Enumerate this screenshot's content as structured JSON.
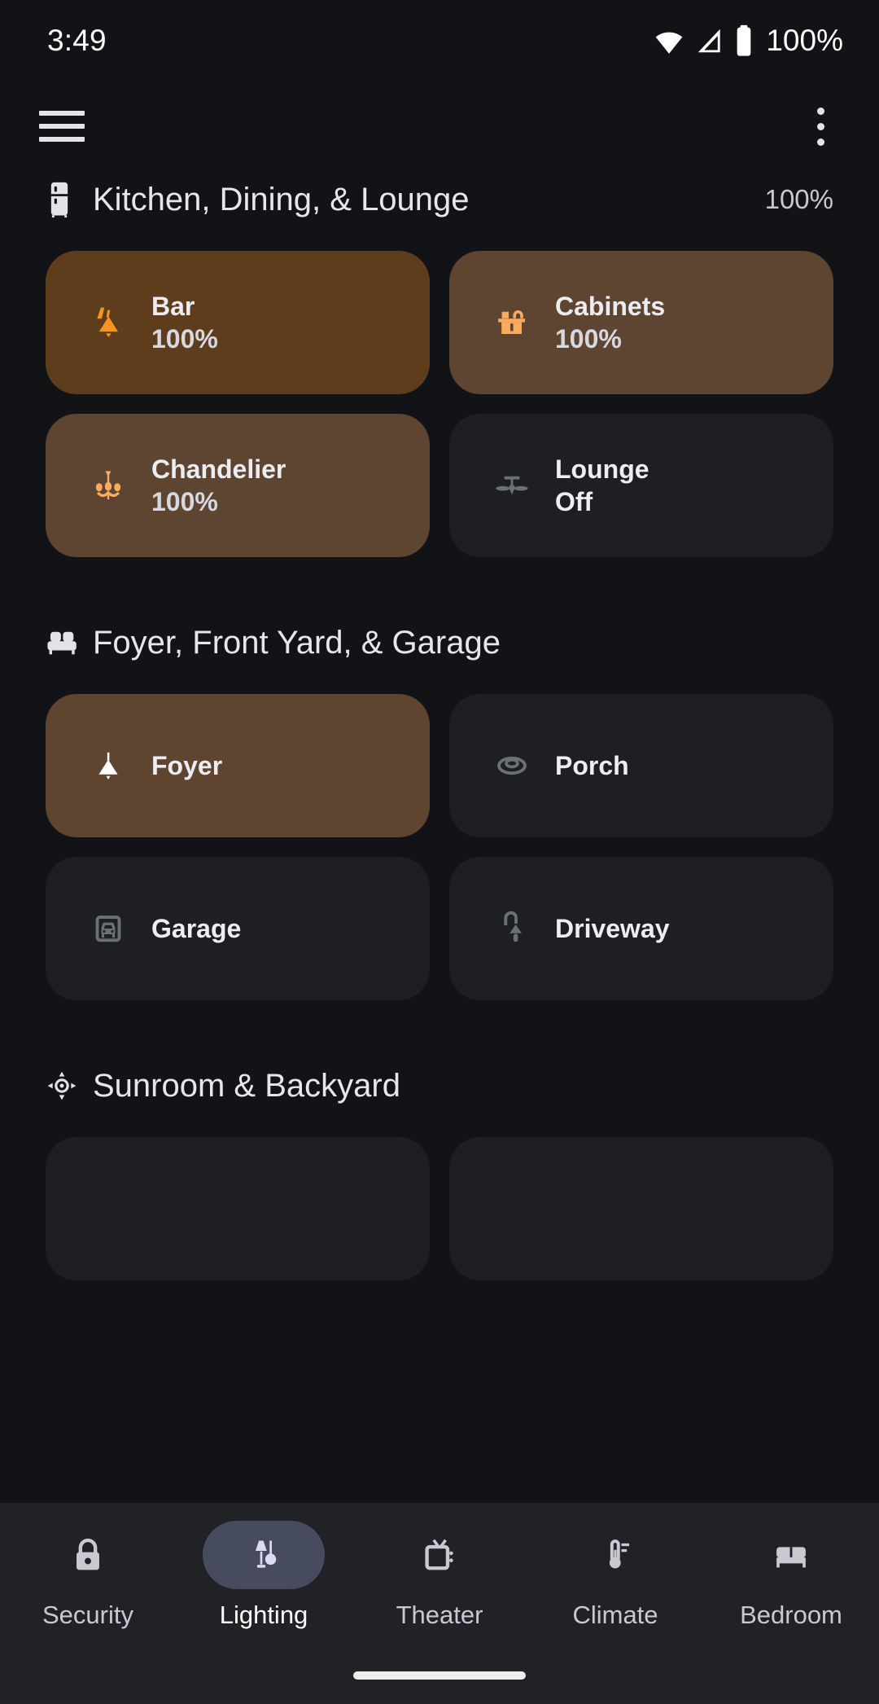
{
  "status_bar": {
    "time": "3:49",
    "battery_text": "100%",
    "icons": [
      "wifi-icon",
      "cellular-signal-icon",
      "battery-icon"
    ]
  },
  "app_bar": {
    "menu_icon": "hamburger-menu-icon",
    "overflow_icon": "more-vertical-icon"
  },
  "colors": {
    "background": "#111316",
    "tile_off": "#1d1f23",
    "tile_on_bright": "#5d3d1b",
    "tile_on_muted": "#5d4532",
    "accent_orange": "#f7941e",
    "accent_orange_light": "#f9ab5e",
    "icon_off": "#6c7076",
    "nav_bar": "#202226",
    "nav_active_pill": "#474b5e",
    "text_primary": "#ececf2"
  },
  "sections": [
    {
      "title": "Kitchen, Dining, & Lounge",
      "icon": "refrigerator-icon",
      "percent": "100%",
      "tiles": [
        {
          "name": "Bar",
          "state": "100%",
          "icon": "wall-sconce-light-icon",
          "on": true,
          "style": "bright"
        },
        {
          "name": "Cabinets",
          "state": "100%",
          "icon": "kitchen-sink-icon",
          "on": true,
          "style": "muted"
        },
        {
          "name": "Chandelier",
          "state": "100%",
          "icon": "chandelier-icon",
          "on": true,
          "style": "muted"
        },
        {
          "name": "Lounge",
          "state": "Off",
          "icon": "ceiling-fan-icon",
          "on": false,
          "style": "off"
        }
      ]
    },
    {
      "title": "Foyer, Front Yard, & Garage",
      "icon": "sofa-icon",
      "percent": "",
      "tiles": [
        {
          "name": "Foyer",
          "state": "",
          "icon": "pendant-light-icon",
          "on": true,
          "style": "foyer"
        },
        {
          "name": "Porch",
          "state": "",
          "icon": "ceiling-dome-light-icon",
          "on": false,
          "style": "off"
        },
        {
          "name": "Garage",
          "state": "",
          "icon": "garage-car-icon",
          "on": false,
          "style": "off"
        },
        {
          "name": "Driveway",
          "state": "",
          "icon": "outdoor-post-lamp-icon",
          "on": false,
          "style": "off"
        }
      ]
    },
    {
      "title": "Sunroom & Backyard",
      "icon": "sun-brightness-icon",
      "percent": "",
      "tiles": [
        {
          "name": "",
          "state": "",
          "icon": "",
          "on": false,
          "style": "off"
        },
        {
          "name": "",
          "state": "",
          "icon": "",
          "on": false,
          "style": "off"
        }
      ]
    }
  ],
  "bottom_nav": {
    "items": [
      {
        "label": "Security",
        "icon": "lock-icon",
        "active": false
      },
      {
        "label": "Lighting",
        "icon": "lamps-icon",
        "active": true
      },
      {
        "label": "Theater",
        "icon": "tv-icon",
        "active": false
      },
      {
        "label": "Climate",
        "icon": "thermometer-icon",
        "active": false
      },
      {
        "label": "Bedroom",
        "icon": "bed-icon",
        "active": false
      }
    ]
  }
}
